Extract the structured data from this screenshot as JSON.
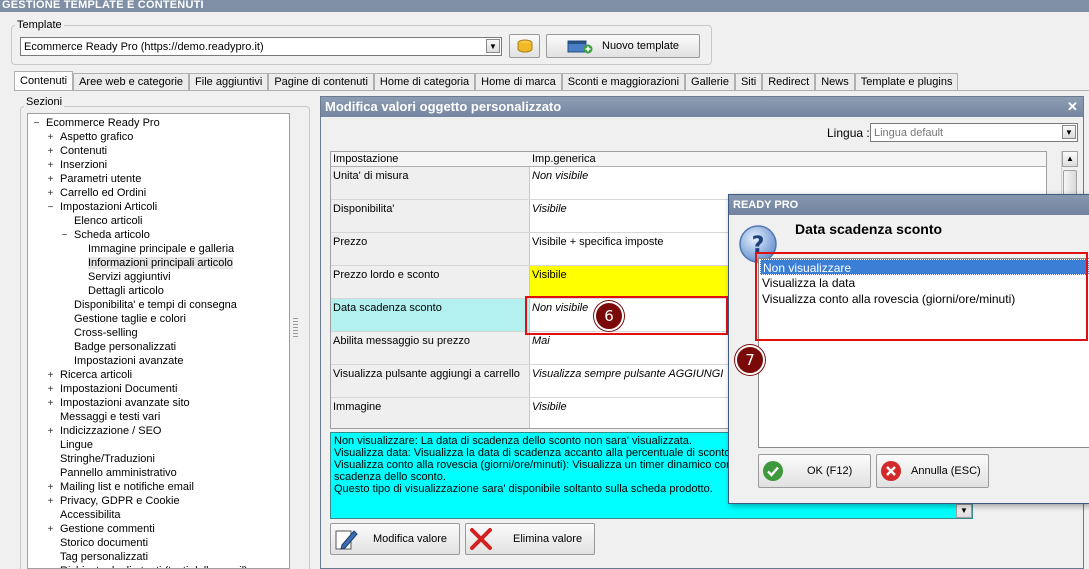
{
  "app_title": "GESTIONE TEMPLATE E CONTENUTI",
  "template_group": {
    "label": "Template",
    "selected": "Ecommerce Ready Pro (https://demo.readypro.it)",
    "new_button": "Nuovo template"
  },
  "tabs": [
    "Contenuti",
    "Aree web e categorie",
    "File aggiuntivi",
    "Pagine di contenuti",
    "Home di categoria",
    "Home di marca",
    "Sconti e maggiorazioni",
    "Gallerie",
    "Siti",
    "Redirect",
    "News",
    "Template e plugins"
  ],
  "sections": {
    "label": "Sezioni",
    "items": [
      {
        "label": "Ecommerce Ready Pro",
        "exp": "−"
      },
      {
        "label": "Aspetto grafico",
        "exp": "+"
      },
      {
        "label": "Contenuti",
        "exp": "+"
      },
      {
        "label": "Inserzioni",
        "exp": "+"
      },
      {
        "label": "Parametri utente",
        "exp": "+"
      },
      {
        "label": "Carrello ed Ordini",
        "exp": "+"
      },
      {
        "label": "Impostazioni Articoli",
        "exp": "−"
      },
      {
        "label": "Elenco articoli",
        "exp": ""
      },
      {
        "label": "Scheda articolo",
        "exp": "−"
      },
      {
        "label": "Immagine principale e galleria",
        "exp": ""
      },
      {
        "label": "Informazioni principali articolo",
        "exp": ""
      },
      {
        "label": "Servizi aggiuntivi",
        "exp": ""
      },
      {
        "label": "Dettagli articolo",
        "exp": ""
      },
      {
        "label": "Disponibilita' e tempi di consegna",
        "exp": ""
      },
      {
        "label": "Gestione taglie e colori",
        "exp": ""
      },
      {
        "label": "Cross-selling",
        "exp": ""
      },
      {
        "label": "Badge personalizzati",
        "exp": ""
      },
      {
        "label": "Impostazioni avanzate",
        "exp": ""
      },
      {
        "label": "Ricerca articoli",
        "exp": "+"
      },
      {
        "label": "Impostazioni Documenti",
        "exp": "+"
      },
      {
        "label": "Impostazioni avanzate sito",
        "exp": "+"
      },
      {
        "label": "Messaggi e testi vari",
        "exp": ""
      },
      {
        "label": "Indicizzazione / SEO",
        "exp": "+"
      },
      {
        "label": "Lingue",
        "exp": ""
      },
      {
        "label": "Stringhe/Traduzioni",
        "exp": ""
      },
      {
        "label": "Pannello amministrativo",
        "exp": ""
      },
      {
        "label": "Mailing list e notifiche email",
        "exp": "+"
      },
      {
        "label": "Privacy, GDPR e Cookie",
        "exp": "+"
      },
      {
        "label": "Accessibilita",
        "exp": ""
      },
      {
        "label": "Gestione commenti",
        "exp": "+"
      },
      {
        "label": "Storico documenti",
        "exp": ""
      },
      {
        "label": "Tag personalizzati",
        "exp": ""
      },
      {
        "label": "Richieste degli utenti (testi delle email)",
        "exp": ""
      }
    ]
  },
  "editor": {
    "title": "Modifica valori oggetto personalizzato",
    "lang_label": "Lingua :",
    "lang_value": "Lingua default",
    "col_setting": "Impostazione",
    "col_value": "Imp.generica",
    "rows": [
      {
        "setting": "Unita' di misura",
        "value": "Non visibile",
        "italic": true
      },
      {
        "setting": "Disponibilita'",
        "value": "Visibile",
        "italic": true
      },
      {
        "setting": "Prezzo",
        "value": "Visibile + specifica imposte",
        "italic": false
      },
      {
        "setting": "Prezzo lordo e sconto",
        "value": "Visibile",
        "italic": false
      },
      {
        "setting": "Data scadenza sconto",
        "value": "Non visibile",
        "italic": true
      },
      {
        "setting": "Abilita messaggio su prezzo",
        "value": "Mai",
        "italic": true
      },
      {
        "setting": "Visualizza pulsante aggiungi a carrello",
        "value": "Visualizza sempre pulsante AGGIUNGI",
        "italic": true
      },
      {
        "setting": "Immagine",
        "value": "Visibile",
        "italic": true
      }
    ],
    "description": [
      "Non visualizzare: La data di scadenza dello sconto non sara' visualizzata.",
      "Visualizza data: Visualizza la data di scadenza accanto alla percentuale di sconto.",
      "Visualizza conto alla rovescia (giorni/ore/minuti): Visualizza un timer dinamico con il t",
      "scadenza dello sconto.",
      "Questo tipo di visualizzazione sara' disponibile soltanto sulla scheda prodotto."
    ],
    "edit_button": "Modifica valore",
    "delete_button": "Elimina valore"
  },
  "dialog": {
    "title": "READY PRO",
    "heading": "Data scadenza sconto",
    "options": [
      "Non visualizzare",
      "Visualizza la data",
      "Visualizza conto alla rovescia (giorni/ore/minuti)"
    ],
    "selected_index": 0,
    "ok_button": "OK (F12)",
    "cancel_button": "Annulla (ESC)"
  },
  "markers": [
    "6",
    "7"
  ],
  "colors": {
    "highlight_row": "#b3f0f0",
    "highlight_value": "#ffff00",
    "description_bg": "#00ffff",
    "annotation_red": "#e01010",
    "marker_bg": "#7a0a0a",
    "selection_blue": "#3a7fd5"
  }
}
